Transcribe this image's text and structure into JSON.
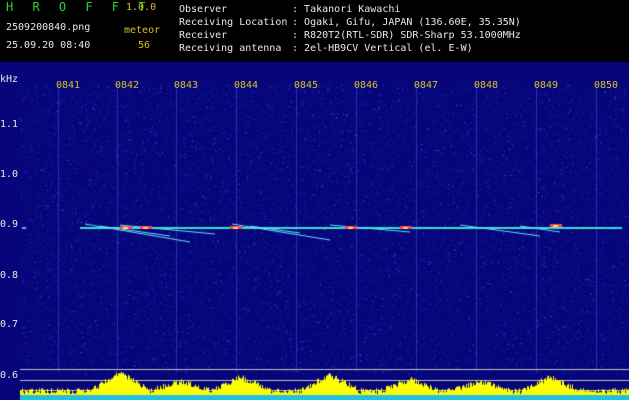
{
  "app": {
    "title": "H R O F F T",
    "version": "1.0.0"
  },
  "file": {
    "name": "2509200840.png",
    "datetime": "25.09.20 08:40"
  },
  "meteor": {
    "label": "meteor",
    "count": "56"
  },
  "station": {
    "observer_label": "Observer",
    "observer": "Takanori Kawachi",
    "location_label": "Receiving Location",
    "location": "Ogaki, Gifu, JAPAN (136.60E, 35.35N)",
    "receiver_label": "Receiver",
    "receiver": "R820T2(RTL-SDR) SDR-Sharp 53.1000MHz",
    "antenna_label": "Receiving antenna",
    "antenna": "2el-HB9CV Vertical (el. E-W)"
  },
  "plot": {
    "unit": "kHz",
    "time_ticks": [
      "0841",
      "0842",
      "0843",
      "0844",
      "0845",
      "0846",
      "0847",
      "0848",
      "0849",
      "0850"
    ],
    "freq_ticks": [
      "1.1",
      "1.0",
      "0.9",
      "0.8",
      "0.7",
      "0.6"
    ],
    "colors": {
      "background": "#06067a",
      "noise": "#2a32c8",
      "carrier": "#38e0d0",
      "meteor": "#ff4060",
      "power": "#ffff00",
      "power_base": "#20c0e0"
    }
  }
}
